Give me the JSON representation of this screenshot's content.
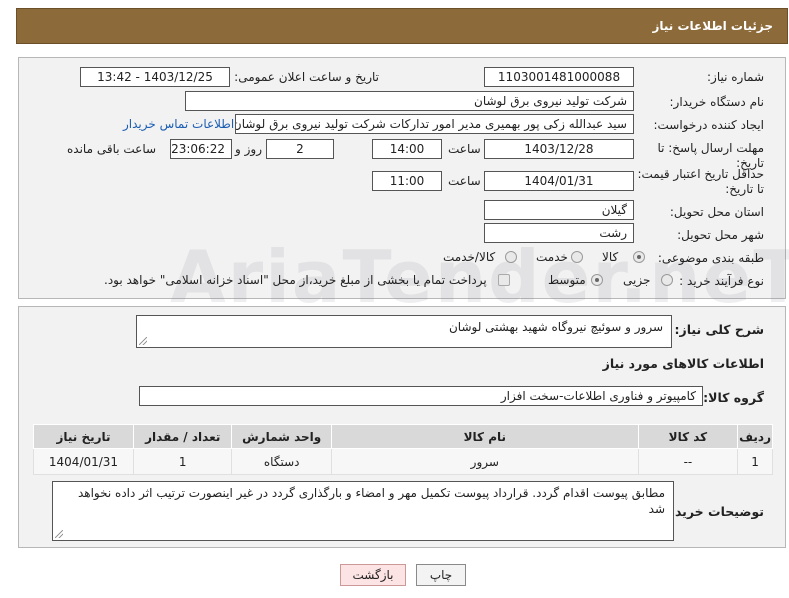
{
  "header": {
    "title": "جزئیات اطلاعات نیاز"
  },
  "watermark": "AriaTender.neT",
  "form": {
    "need_number_label": "شماره نیاز:",
    "need_number": "1103001481000088",
    "announce_label": "تاریخ و ساعت اعلان عمومی:",
    "announce_value": "1403/12/25 - 13:42",
    "buyer_label": "نام دستگاه خریدار:",
    "buyer_value": "شرکت تولید نیروی برق لوشان",
    "creator_label": "ایجاد کننده درخواست:",
    "creator_value": "سید عبدالله زکی پور بهمیری مدیر امور تدارکات شرکت تولید نیروی برق لوشان",
    "contact_link": "اطلاعات تماس خریدار",
    "deadline_label": "مهلت ارسال پاسخ: تا تاریخ:",
    "deadline_date": "1403/12/28",
    "time_label": "ساعت",
    "deadline_time": "14:00",
    "days_value": "2",
    "days_label": "روز و",
    "remaining_value": "23:06:22",
    "remaining_label": "ساعت باقی مانده",
    "price_label": "حداقل تاریخ اعتبار قیمت: تا تاریخ:",
    "price_date": "1404/01/31",
    "price_time": "11:00",
    "province_label": "استان محل تحویل:",
    "province_value": "گیلان",
    "city_label": "شهر محل تحویل:",
    "city_value": "رشت",
    "category_label": "طبقه بندی موضوعی:",
    "category_options": [
      "کالا",
      "خدمت",
      "کالا/خدمت"
    ],
    "process_label": "نوع فرآیند خرید :",
    "process_options": [
      "جزیی",
      "متوسط"
    ],
    "payment_note": "پرداخت تمام یا بخشی از مبلغ خرید،از محل \"اسناد خزانه اسلامی\" خواهد بود."
  },
  "details": {
    "summary_label": "شرح کلی نیاز:",
    "summary_value": "سرور و سوئیچ نیروگاه شهید بهشتی لوشان",
    "goods_title": "اطلاعات کالاهای مورد نیاز",
    "group_label": "گروه کالا:",
    "group_value": "کامپیوتر و فناوری اطلاعات-سخت افزار",
    "table": {
      "headers": [
        "ردیف",
        "کد کالا",
        "نام کالا",
        "واحد شمارش",
        "تعداد / مقدار",
        "تاریخ نیاز"
      ],
      "rows": [
        [
          "1",
          "--",
          "سرور",
          "دستگاه",
          "1",
          "1404/01/31"
        ]
      ]
    },
    "buyer_notes_label": "توضیحات خریدار:",
    "buyer_notes_value": "مطابق پیوست اقدام گردد. قرارداد پیوست تکمیل مهر و امضاء و بارگذاری گردد در غیر اینصورت ترتیب اثر داده نخواهد شد"
  },
  "buttons": {
    "print": "چاپ",
    "back": "بازگشت"
  }
}
